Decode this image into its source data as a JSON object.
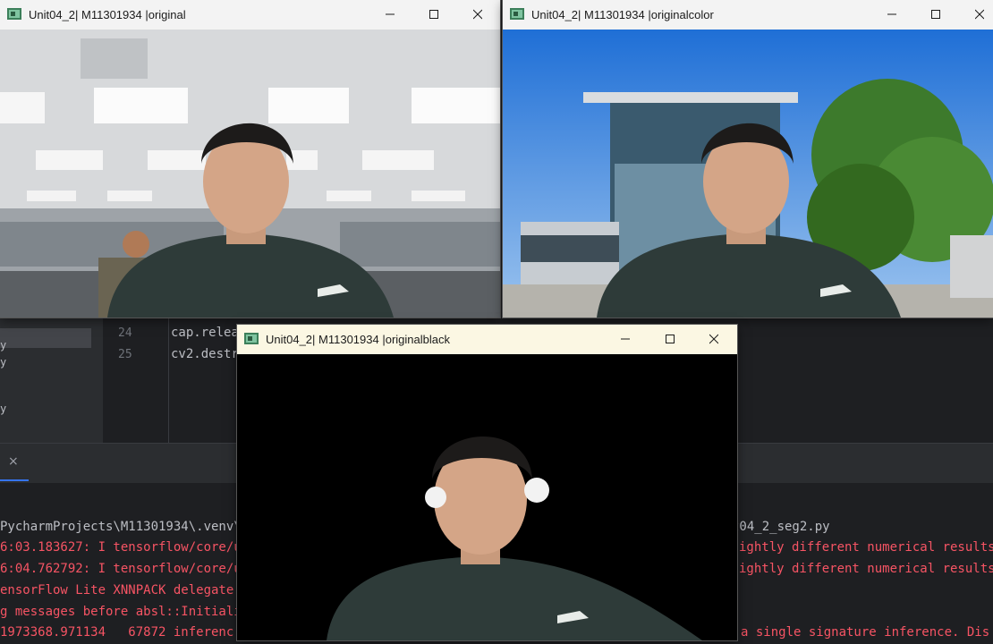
{
  "ide": {
    "project_rows": [
      "y",
      "y",
      "y",
      "y"
    ],
    "editor": {
      "lines": [
        {
          "num": "24",
          "code": "cap.relea"
        },
        {
          "num": "25",
          "code": "cv2.destr"
        }
      ]
    },
    "run_close": "×",
    "console": {
      "left_lines": [
        {
          "text": "PycharmProjects\\M11301934\\.venv\\",
          "kind": "norm"
        },
        {
          "text": "6:03.183627: I tensorflow/core/u",
          "kind": "err"
        },
        {
          "text": "6:04.762792: I tensorflow/core/u",
          "kind": "err"
        },
        {
          "text": "ensorFlow Lite XNNPACK delegate ",
          "kind": "err"
        },
        {
          "text": "g messages before absl::Initiali",
          "kind": "err"
        },
        {
          "text": "1973368.971134   67872 inferenc",
          "kind": "err"
        }
      ],
      "right_lines": [
        {
          "text": "t04_2_seg2.py",
          "kind": "norm"
        },
        {
          "text": "ightly different numerical results",
          "kind": "err"
        },
        {
          "text": "ightly different numerical results",
          "kind": "err"
        },
        {
          "text": "",
          "kind": "err"
        },
        {
          "text": "",
          "kind": "err"
        },
        {
          "text": "a single signature inference. Dis",
          "kind": "err"
        }
      ]
    }
  },
  "windows": {
    "original": {
      "title": "Unit04_2| M11301934 |original"
    },
    "originalcolor": {
      "title": "Unit04_2| M11301934 |originalcolor"
    },
    "originalblack": {
      "title": "Unit04_2| M11301934 |originalblack"
    }
  },
  "window_controls": {
    "minimize": "—",
    "maximize": "☐",
    "close": "✕"
  },
  "colors": {
    "console_error": "#f75464",
    "console_text": "#bcbec4",
    "accent": "#3574f0"
  }
}
